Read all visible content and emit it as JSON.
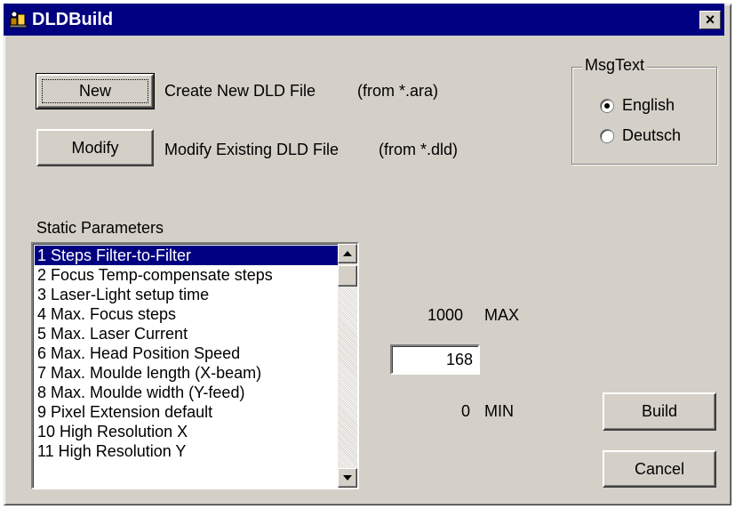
{
  "window": {
    "title": "DLDBuild",
    "close_label": "×"
  },
  "buttons": {
    "new": "New",
    "modify": "Modify",
    "build": "Build",
    "cancel": "Cancel"
  },
  "descriptions": {
    "new": "Create New DLD File",
    "new_hint": "(from *.ara)",
    "modify": "Modify Existing DLD File",
    "modify_hint": "(from *.dld)"
  },
  "msgtext": {
    "title": "MsgText",
    "options": [
      "English",
      "Deutsch"
    ],
    "selected": "English"
  },
  "static_parameters": {
    "label": "Static Parameters",
    "selected_index": 0,
    "items": [
      "1 Steps Filter-to-Filter",
      "2 Focus Temp-compensate steps",
      "3 Laser-Light setup time",
      "4 Max. Focus steps",
      "5 Max. Laser Current",
      "6 Max. Head Position Speed",
      "7 Max. Moulde length (X-beam)",
      "8 Max. Moulde width  (Y-feed)",
      "9 Pixel Extension default",
      "10 High Resolution X",
      "11 High Resolution Y"
    ]
  },
  "range": {
    "max_value": "1000",
    "max_label": "MAX",
    "current_value": "168",
    "min_value": "0",
    "min_label": "MIN"
  },
  "colors": {
    "titlebar": "#000080",
    "face": "#d4d0c8",
    "selection": "#000080"
  }
}
